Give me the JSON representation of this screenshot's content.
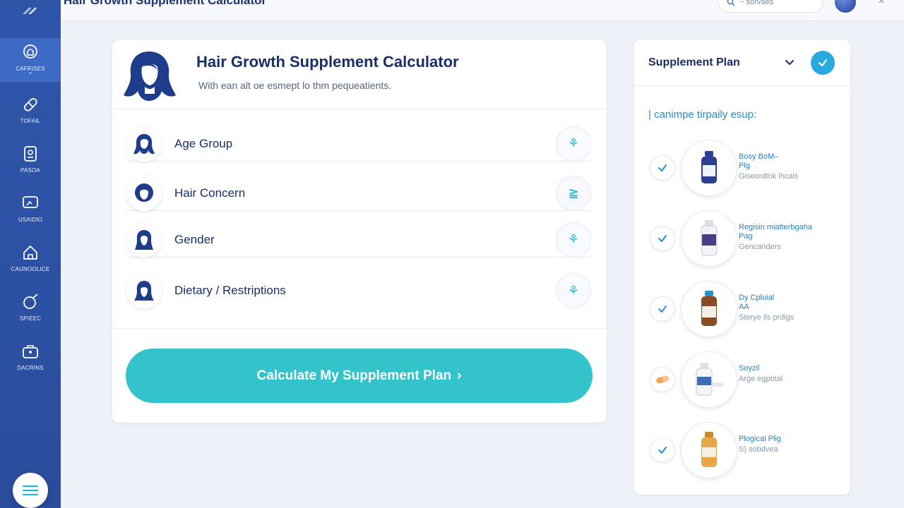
{
  "app": {
    "title": "Hair Growth Supplement Calculator",
    "search_text": "~ sorvaes"
  },
  "sidebar": {
    "items": [
      {
        "label": "CAFRISES",
        "sub": "⌃",
        "icon": "head-profile-icon"
      },
      {
        "label": "TOFAIL",
        "sub": "",
        "icon": "capsule-icon"
      },
      {
        "label": "PASOA",
        "sub": "",
        "icon": "document-icon"
      },
      {
        "label": "USAIDIO",
        "sub": "",
        "icon": "monitor-icon"
      },
      {
        "label": "CAUNOOLICE",
        "sub": "",
        "icon": "home-icon"
      },
      {
        "label": "SPIEEC",
        "sub": "",
        "icon": "edit-circle-icon"
      },
      {
        "label": "DACRINS",
        "sub": "",
        "icon": "briefcase-icon"
      }
    ],
    "menu_icon": "menu-icon"
  },
  "calculator": {
    "title": "Hair Growth Supplement Calculator",
    "subtitle": "With ean alt oe esmept lo thm pequeatients.",
    "fields": [
      {
        "label": "Age Group",
        "action_glyph": "⚘",
        "icon": "hair-profile-icon"
      },
      {
        "label": "Hair Concern",
        "action_glyph": "≧",
        "icon": "hair-profile-icon"
      },
      {
        "label": "Gender",
        "action_glyph": "⚘",
        "icon": "hair-profile-icon"
      },
      {
        "label": "Dietary / Restriptions",
        "action_glyph": "⚘",
        "icon": "hair-profile-icon"
      }
    ],
    "button_label": "Calculate My Supplement Plan",
    "button_arrow": "›"
  },
  "plan": {
    "title": "Supplement Plan",
    "intro": "| canimpe tirpaily esup:",
    "items": [
      {
        "name": "Bosy BoM–\nPlg",
        "desc": "Giseordtnk ihcals",
        "status": "check",
        "bottle": "#2c3e8f"
      },
      {
        "name": "Regisin miatterbgaha\nPag",
        "desc": "Gencanders",
        "status": "check",
        "bottle": "#4a3d86"
      },
      {
        "name": "Dy Cpluial\nAA",
        "desc": "Storye lls prdigs",
        "status": "check",
        "bottle": "#8a4c24"
      },
      {
        "name": "Soyzil",
        "desc": "Arge egpotal",
        "status": "pill",
        "bottle": "#3e6fb5"
      },
      {
        "name": "Plogical Plig",
        "desc": "S) sobdvea",
        "status": "check",
        "bottle": "#c98a2e"
      }
    ]
  },
  "colors": {
    "sidebar": "#2f56ab",
    "accent": "#33c3cb",
    "title": "#1a2f66",
    "link": "#2b7fb8"
  }
}
